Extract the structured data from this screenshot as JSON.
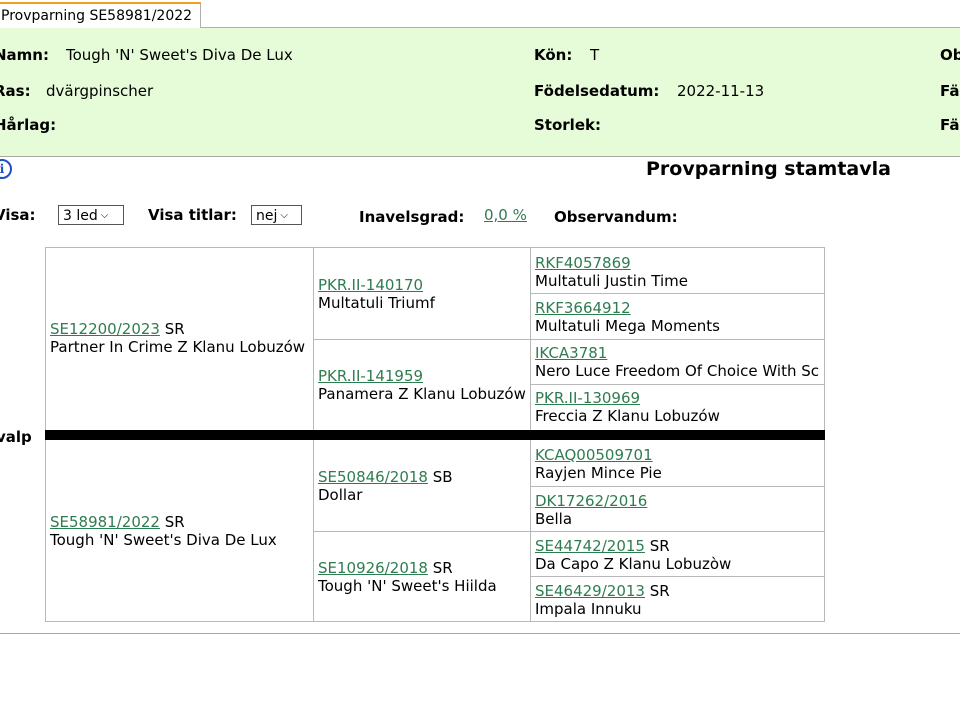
{
  "tab": {
    "label": "Provparning SE58981/2022"
  },
  "info": {
    "namn_label": "Namn:",
    "namn_value": "Tough 'N' Sweet's Diva De Lux",
    "kon_label": "Kön:",
    "kon_value": "T",
    "ob_label": "Ob",
    "ras_label": "Ras:",
    "ras_value": "dvärgpinscher",
    "fodelse_label": "Födelsedatum:",
    "fodelse_value": "2022-11-13",
    "fa1_label": "Fä",
    "harlag_label": "Hårlag:",
    "storlek_label": "Storlek:",
    "fa2_label": "Fä"
  },
  "page_title": "Provparning stamtavla",
  "controls": {
    "visa_label": "Visa:",
    "visa_value": "3 led",
    "titlar_label": "Visa titlar:",
    "titlar_value": "nej",
    "inavel_label": "Inavelsgrad:",
    "inavel_value": "0,0 %",
    "observandum_label": "Observandum:"
  },
  "valp_label": "valp",
  "pedigree": {
    "sire": {
      "reg": "SE12200/2023",
      "suffix": "SR",
      "name": "Partner In Crime Z Klanu Lobuzów"
    },
    "sire_sire": {
      "reg": "PKR.II-140170",
      "suffix": "",
      "name": "Multatuli Triumf"
    },
    "sire_dam": {
      "reg": "PKR.II-141959",
      "suffix": "",
      "name": "Panamera Z Klanu Lobuzów"
    },
    "ss_sire": {
      "reg": "RKF4057869",
      "suffix": "",
      "name": "Multatuli Justin Time"
    },
    "ss_dam": {
      "reg": "RKF3664912",
      "suffix": "",
      "name": "Multatuli Mega Moments"
    },
    "sd_sire": {
      "reg": "IKCA3781",
      "suffix": "",
      "name": "Nero Luce Freedom Of Choice With Sc"
    },
    "sd_dam": {
      "reg": "PKR.II-130969",
      "suffix": "",
      "name": "Freccia Z Klanu Lobuzów"
    },
    "dam": {
      "reg": "SE58981/2022",
      "suffix": "SR",
      "name": "Tough 'N' Sweet's Diva De Lux"
    },
    "dam_sire": {
      "reg": "SE50846/2018",
      "suffix": "SB",
      "name": "Dollar"
    },
    "dam_dam": {
      "reg": "SE10926/2018",
      "suffix": "SR",
      "name": "Tough 'N' Sweet's Hiilda"
    },
    "ds_sire": {
      "reg": "KCAQ00509701",
      "suffix": "",
      "name": "Rayjen Mince Pie"
    },
    "ds_dam": {
      "reg": "DK17262/2016",
      "suffix": "",
      "name": "Bella"
    },
    "dd_sire": {
      "reg": "SE44742/2015",
      "suffix": "SR",
      "name": "Da Capo Z Klanu Lobuzòw"
    },
    "dd_dam": {
      "reg": "SE46429/2013",
      "suffix": "SR",
      "name": "Impala Innuku"
    }
  },
  "colors": {
    "info_bg": "#e6fbd7",
    "link": "#2e7d50",
    "tab_accent": "#f0a020"
  }
}
